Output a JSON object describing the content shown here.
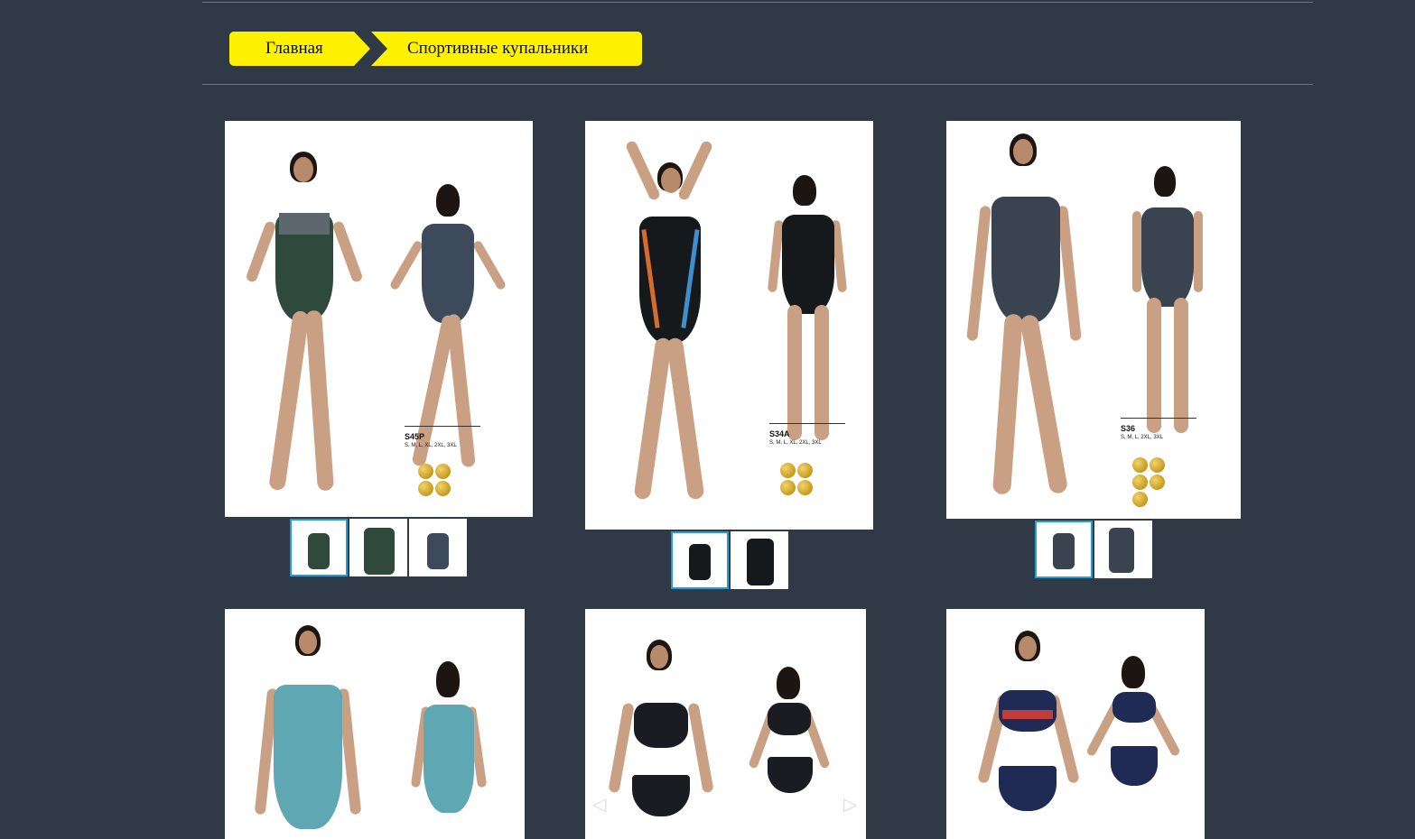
{
  "breadcrumb": {
    "home_label": "Главная",
    "category_label": "Спортивные купальники"
  },
  "colors": {
    "background": "#303a46",
    "breadcrumb": "#fff200",
    "thumb_active_border": "#1ea0d6"
  },
  "products": [
    {
      "code": "S45P",
      "sizes": "S, M, L, XL, 2XL, 3XL",
      "suit_color": "#2f4a3d",
      "thumbs": 3
    },
    {
      "code": "S34A",
      "sizes": "S, M, L, XL, 2XL, 3XL",
      "suit_color": "#16191c",
      "thumbs": 2
    },
    {
      "code": "S36",
      "sizes": "S, M, L, 2XL, 3XL",
      "suit_color": "#3a4350",
      "thumbs": 2
    },
    {
      "code": "",
      "sizes": "",
      "suit_color": "#5fa7b3"
    },
    {
      "code": "",
      "sizes": "",
      "suit_color": "#1a1c22"
    },
    {
      "code": "",
      "sizes": "",
      "suit_color": "#1f2a55"
    }
  ],
  "carousel": {
    "prev_icon": "◁",
    "next_icon": "▷"
  }
}
